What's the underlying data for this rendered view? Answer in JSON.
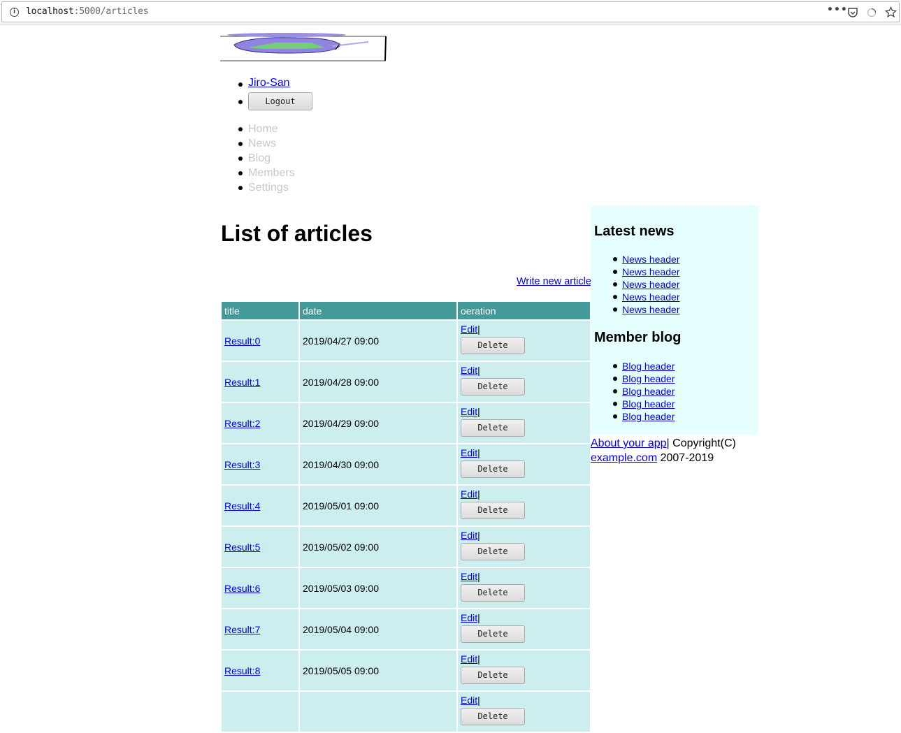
{
  "browser": {
    "url_host": "localhost",
    "url_path": ":5000/articles",
    "more_icon": "more-icon",
    "pocket_icon": "pocket-icon",
    "loading_icon": "loading-icon",
    "bookmark_icon": "bookmark-star-icon"
  },
  "user_menu": {
    "username": "Jiro-San",
    "logout_label": "Logout"
  },
  "nav": {
    "items": [
      "Home",
      "News",
      "Blog",
      "Members",
      "Settings"
    ]
  },
  "main": {
    "title": "List of articles",
    "write_new_label": "Write new article",
    "table": {
      "headers": [
        "title",
        "date",
        "oeration"
      ],
      "edit_label": "Edit",
      "separator": "|",
      "delete_label": "Delete",
      "rows": [
        {
          "title": "Result:0",
          "date": "2019/04/27 09:00"
        },
        {
          "title": "Result:1",
          "date": "2019/04/28 09:00"
        },
        {
          "title": "Result:2",
          "date": "2019/04/29 09:00"
        },
        {
          "title": "Result:3",
          "date": "2019/04/30 09:00"
        },
        {
          "title": "Result:4",
          "date": "2019/05/01 09:00"
        },
        {
          "title": "Result:5",
          "date": "2019/05/02 09:00"
        },
        {
          "title": "Result:6",
          "date": "2019/05/03 09:00"
        },
        {
          "title": "Result:7",
          "date": "2019/05/04 09:00"
        },
        {
          "title": "Result:8",
          "date": "2019/05/05 09:00"
        },
        {
          "title": "",
          "date": ""
        }
      ]
    }
  },
  "sidebar": {
    "news_heading": "Latest news",
    "news_items": [
      "News header",
      "News header",
      "News header",
      "News header",
      "News header"
    ],
    "blog_heading": "Member blog",
    "blog_items": [
      "Blog header",
      "Blog header",
      "Blog header",
      "Blog header",
      "Blog header"
    ]
  },
  "footer": {
    "about_label": "About your app",
    "copyright_text": "| Copyright(C)",
    "site_link": "example.com",
    "years": " 2007-2019"
  },
  "colors": {
    "table_header": "#449999",
    "table_cell": "#cceeee",
    "sidebar_bg": "#e6ffff",
    "nav_text": "#c8c8c8",
    "link": "#0000ee"
  }
}
